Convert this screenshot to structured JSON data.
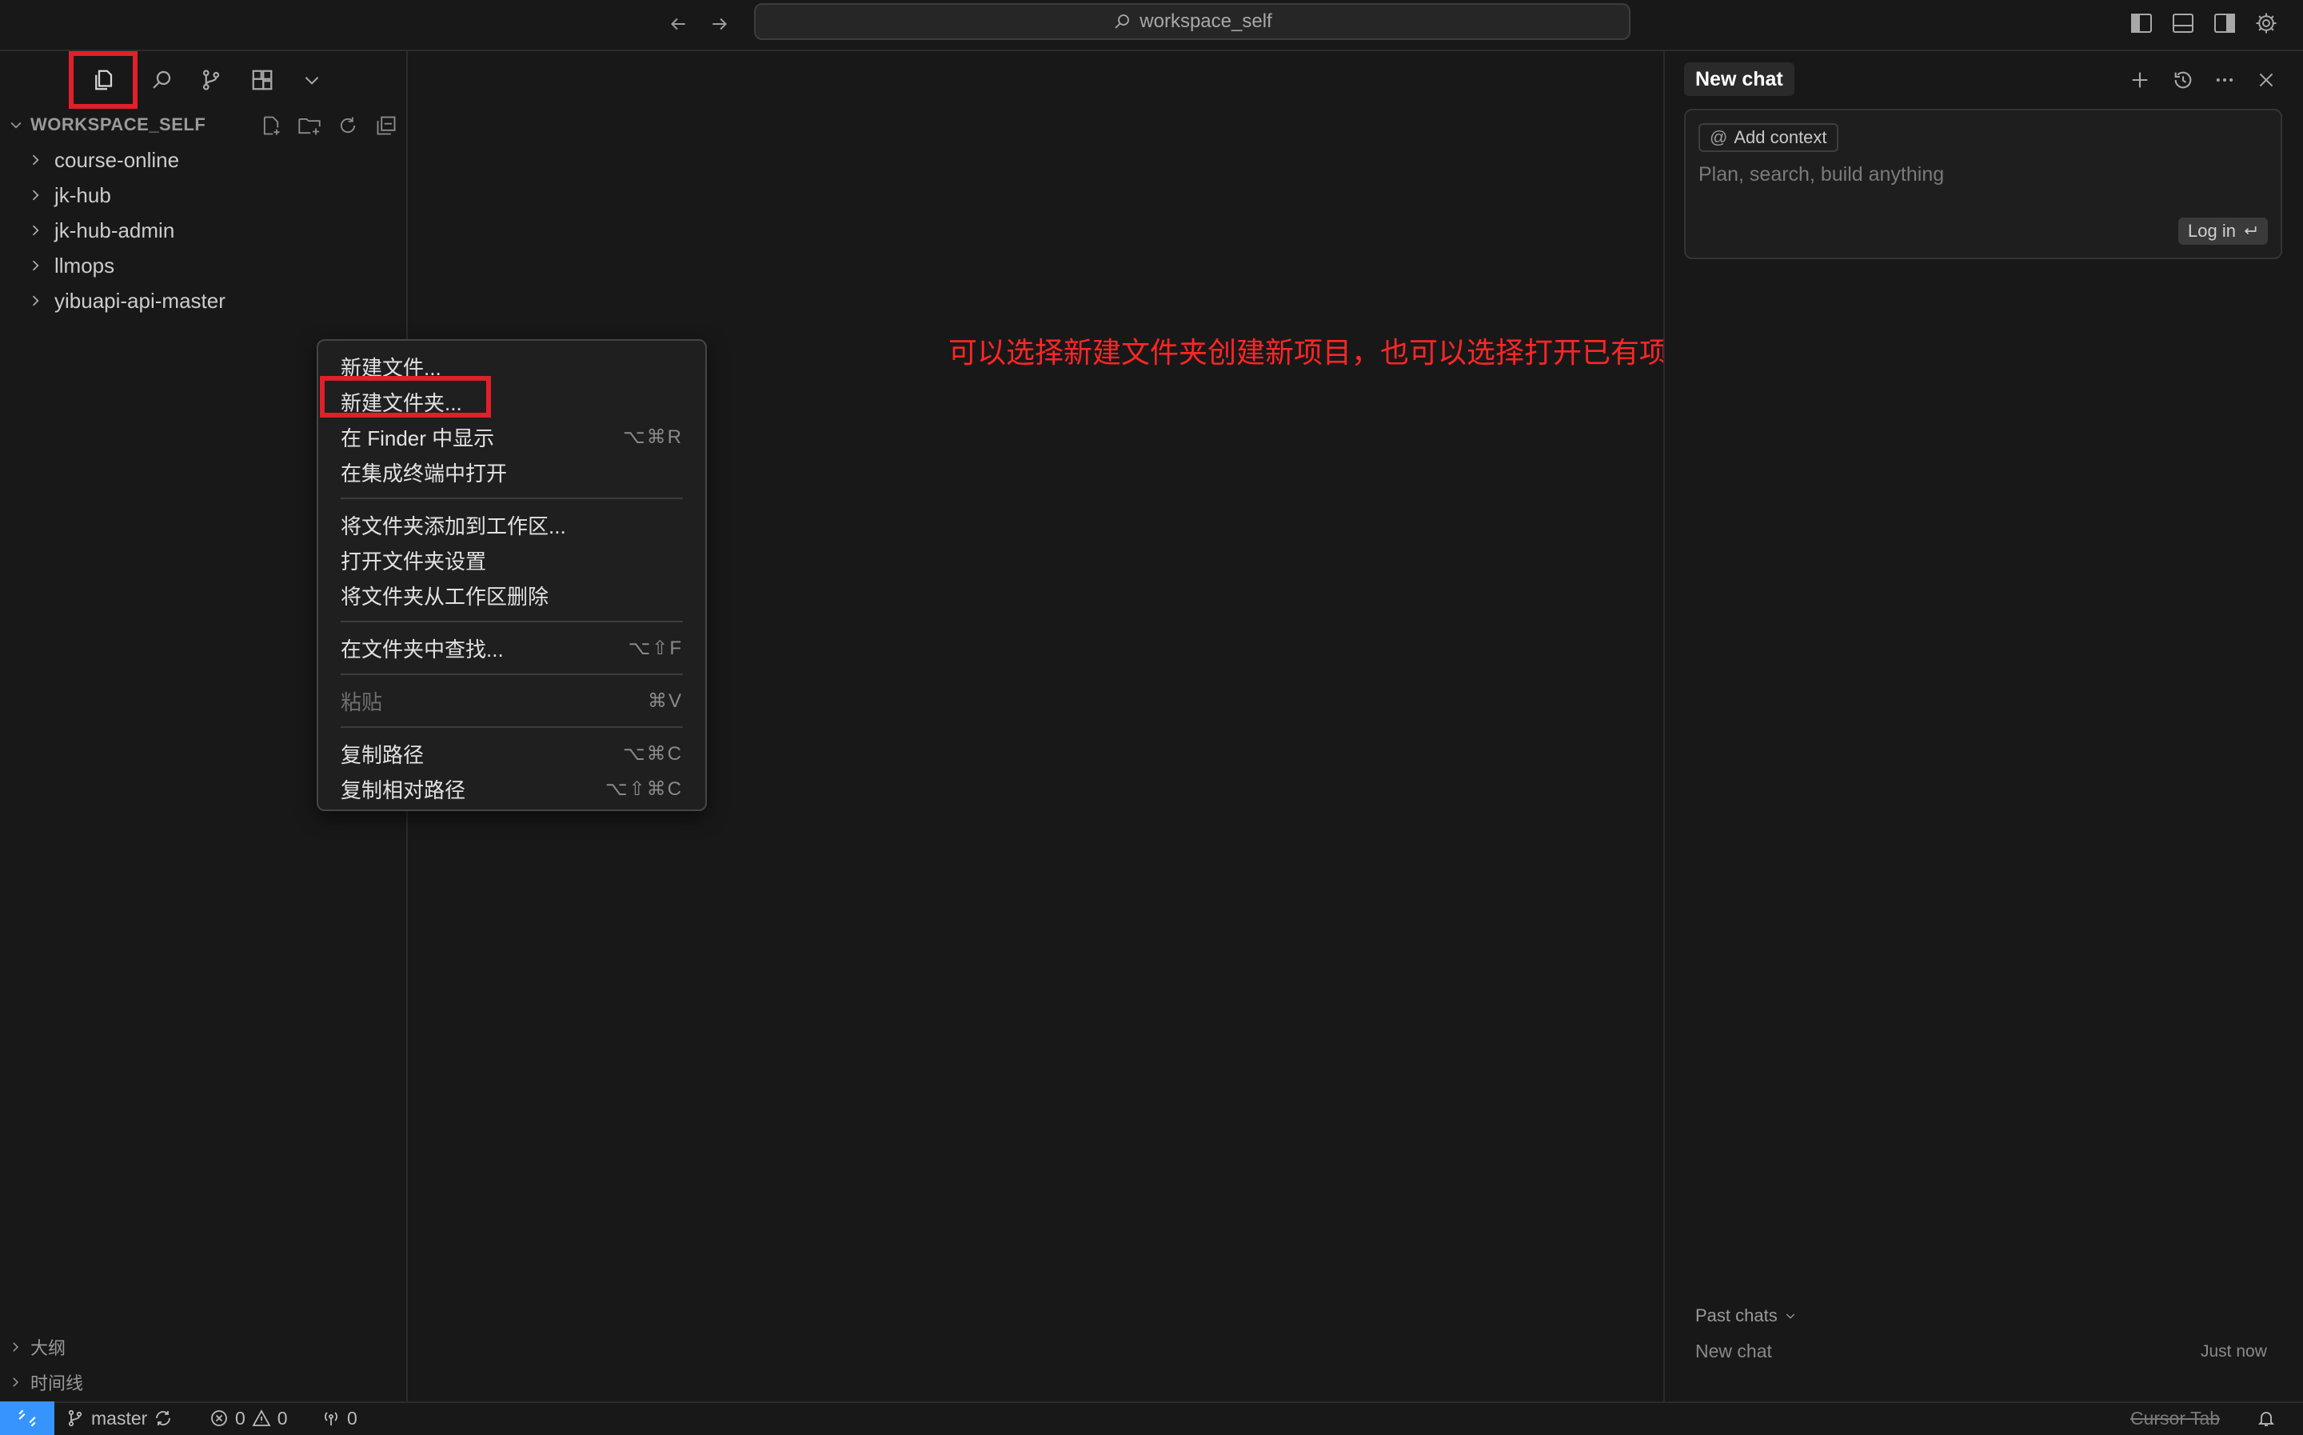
{
  "titlebar": {
    "search_text": "workspace_self"
  },
  "explorer": {
    "workspace_title": "WORKSPACE_SELF",
    "folders": [
      "course-online",
      "jk-hub",
      "jk-hub-admin",
      "llmops",
      "yibuapi-api-master"
    ],
    "outline_label": "大纲",
    "timeline_label": "时间线"
  },
  "context_menu": {
    "new_file": "新建文件...",
    "new_folder": "新建文件夹...",
    "reveal_finder": "在 Finder 中显示",
    "reveal_finder_shortcut": "⌥⌘R",
    "open_terminal": "在集成终端中打开",
    "add_folder_workspace": "将文件夹添加到工作区...",
    "open_folder_settings": "打开文件夹设置",
    "remove_folder_workspace": "将文件夹从工作区删除",
    "find_in_folder": "在文件夹中查找...",
    "find_in_folder_shortcut": "⌥⇧F",
    "paste": "粘贴",
    "paste_shortcut": "⌘V",
    "copy_path": "复制路径",
    "copy_path_shortcut": "⌥⌘C",
    "copy_relative_path": "复制相对路径",
    "copy_relative_path_shortcut": "⌥⇧⌘C"
  },
  "annotation": "可以选择新建文件夹创建新项目，也可以选择打开已有项目",
  "chat": {
    "tab_label": "New chat",
    "add_context": "Add context",
    "placeholder": "Plan, search, build anything",
    "login": "Log in",
    "past_chats": "Past chats",
    "past_chat_title": "New chat",
    "past_chat_time": "Just now"
  },
  "statusbar": {
    "branch": "master",
    "errors": "0",
    "warnings": "0",
    "ports": "0",
    "cursor_tab": "Cursor Tab"
  },
  "colors": {
    "accent": "#3794ff",
    "highlight_box": "#e0202a",
    "annotation": "#ff2626"
  }
}
